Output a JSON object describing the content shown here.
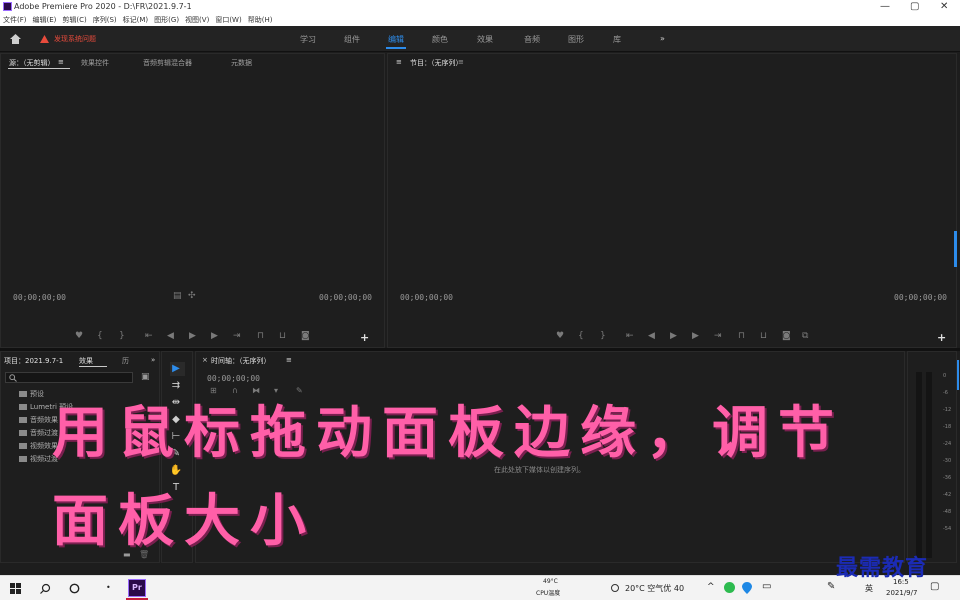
{
  "titlebar": {
    "title": "Adobe Premiere Pro 2020 - D:\\FR\\2021.9.7-1",
    "minimize": "—",
    "restore": "▢",
    "close": "✕"
  },
  "menubar": {
    "items": [
      "文件(F)",
      "编辑(E)",
      "剪辑(C)",
      "序列(S)",
      "标记(M)",
      "图形(G)",
      "视图(V)",
      "窗口(W)",
      "帮助(H)"
    ]
  },
  "workbar": {
    "home_icon": "home-icon",
    "warning_text": "发现系统问题",
    "workspaces": [
      "学习",
      "组件",
      "编辑",
      "颜色",
      "效果",
      "音频",
      "图形",
      "库"
    ],
    "active_workspace": "编辑",
    "more": "»"
  },
  "source_panel": {
    "tabs": [
      "源：（无剪辑）",
      "效果控件",
      "音频剪辑混合器",
      "元数据"
    ],
    "menu": "≡",
    "timecode_left": "00;00;00;00",
    "timecode_right": "00;00;00;00",
    "add": "+"
  },
  "program_panel": {
    "tab": "节目：（无序列）",
    "menu": "≡",
    "timecode_left": "00;00;00;00",
    "timecode_right": "00;00;00;00",
    "add": "+"
  },
  "project_panel": {
    "tabs": [
      "项目：2021.9.7-1",
      "效果",
      "历"
    ],
    "more": "»",
    "folders": [
      "预设",
      "Lumetri 预设",
      "音频效果",
      "音频过渡",
      "视频效果",
      "视频过渡"
    ]
  },
  "timeline_panel": {
    "tab": "时间轴：（无序列）",
    "menu": "≡",
    "close": "×",
    "timecode": "00;00;00;00",
    "empty_message": "在此处放下媒体以创建序列。"
  },
  "audio_meter": {
    "labels": [
      "0",
      "-6",
      "-12",
      "-18",
      "-24",
      "-30",
      "-36",
      "-42",
      "-48",
      "-54"
    ]
  },
  "overlay": {
    "line1": "用鼠标拖动面板边缘，调节",
    "line2": "面板大小"
  },
  "taskbar": {
    "cpu_value": "49°C",
    "cpu_label": "CPU温度",
    "weather": "20°C 空气优 40",
    "ime": "英",
    "time": "16:5",
    "date": "2021/9/7",
    "app_label": "Pr"
  },
  "watermark": "最需教育",
  "colors": {
    "accent": "#2d8ceb",
    "warning": "#e84b3c",
    "overlay_text": "#ff5fa8",
    "watermark": "#1b2bb5"
  }
}
